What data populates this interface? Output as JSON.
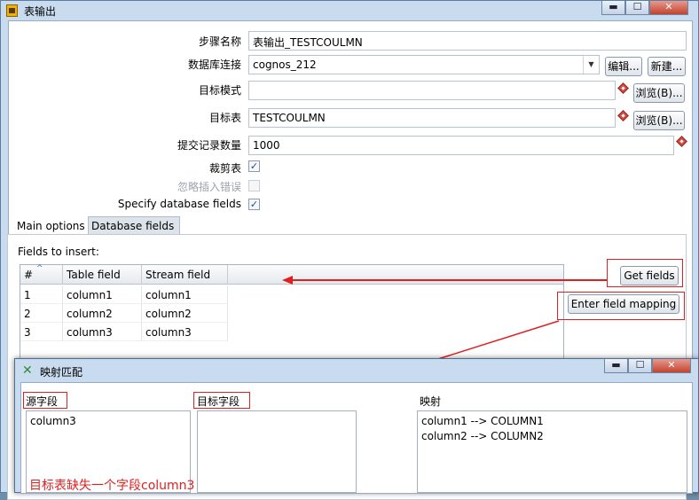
{
  "main_window": {
    "title": "表输出",
    "buttons": {
      "minimize": "▬",
      "maximize": "☐",
      "close": "✕"
    }
  },
  "form": {
    "step_name_label": "步骤名称",
    "step_name_value": "表输出_TESTCOULMN",
    "connection_label": "数据库连接",
    "connection_value": "cognos_212",
    "edit_button": "编辑...",
    "new_button": "新建...",
    "schema_label": "目标模式",
    "schema_value": "",
    "browse_schema_button": "浏览(B)...",
    "table_label": "目标表",
    "table_value": "TESTCOULMN",
    "browse_table_button": "浏览(B)...",
    "commit_label": "提交记录数量",
    "commit_value": "1000",
    "truncate_label": "裁剪表",
    "truncate_checked": true,
    "ignore_errors_label": "忽略插入错误",
    "ignore_errors_checked": false,
    "specify_fields_label": "Specify database fields",
    "specify_fields_checked": true
  },
  "tabs": [
    {
      "label": "Main options"
    },
    {
      "label": "Database fields"
    }
  ],
  "fields_panel": {
    "fields_label": "Fields to insert:",
    "columns": [
      "#",
      "Table field",
      "Stream field"
    ],
    "rows": [
      {
        "n": "1",
        "table_field": "column1",
        "stream_field": "column1"
      },
      {
        "n": "2",
        "table_field": "column2",
        "stream_field": "column2"
      },
      {
        "n": "3",
        "table_field": "column3",
        "stream_field": "column3"
      }
    ],
    "get_fields_button": "Get fields",
    "enter_mapping_button": "Enter field mapping"
  },
  "mapping_dialog": {
    "title": "映射匹配",
    "source_label": "源字段",
    "source_items": [
      "column3"
    ],
    "target_label": "目标字段",
    "target_items": [],
    "mapping_label": "映射",
    "mapping_items": [
      "column1 --> COLUMN1",
      "column2 --> COLUMN2"
    ],
    "annotation": "目标表缺失一个字段column3"
  },
  "colors": {
    "annotation_red": "#e02020",
    "window_frame": "#c9dbee"
  }
}
